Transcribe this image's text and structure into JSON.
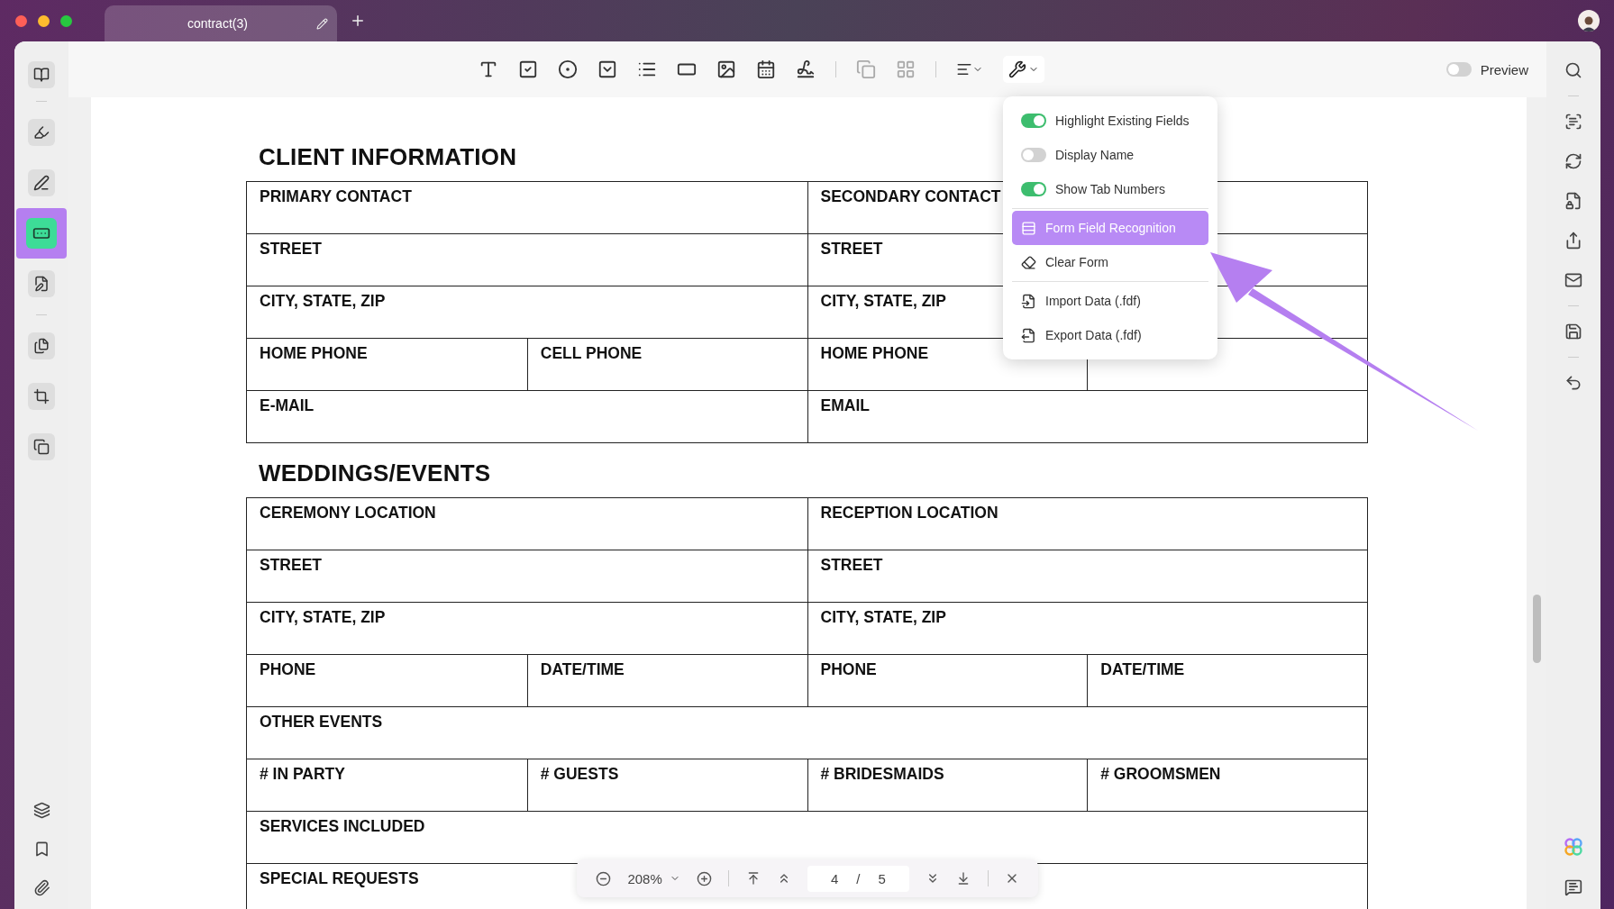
{
  "tab": {
    "title": "contract(3)"
  },
  "left_sidebar": {
    "tools": [
      {
        "selected": false
      },
      {
        "selected": false
      },
      {
        "selected": true
      },
      {
        "selected": false
      },
      {
        "selected": false
      },
      {
        "selected": false
      },
      {
        "selected": false
      }
    ]
  },
  "preview": {
    "label": "Preview",
    "on": false
  },
  "form_menu": {
    "groups": [
      {
        "items": [
          {
            "kind": "toggle",
            "label": "Highlight Existing Fields",
            "on": true
          },
          {
            "kind": "toggle",
            "label": "Display Name",
            "on": false
          },
          {
            "kind": "toggle",
            "label": "Show Tab Numbers",
            "on": true
          }
        ]
      },
      {
        "items": [
          {
            "kind": "action",
            "label": "Form Field Recognition",
            "selected": true
          },
          {
            "kind": "action",
            "label": "Clear Form",
            "selected": false
          }
        ]
      },
      {
        "items": [
          {
            "kind": "action",
            "label": "Import Data (.fdf)",
            "selected": false
          },
          {
            "kind": "action",
            "label": "Export Data (.fdf)",
            "selected": false
          }
        ]
      }
    ]
  },
  "document": {
    "sections": [
      {
        "title": "CLIENT INFORMATION",
        "rows": [
          {
            "cells": [
              {
                "label": "PRIMARY CONTACT"
              },
              {
                "label": "SECONDARY CONTACT"
              }
            ]
          },
          {
            "cells": [
              {
                "label": "STREET"
              },
              {
                "label": "STREET"
              }
            ]
          },
          {
            "cells": [
              {
                "label": "CITY, STATE, ZIP"
              },
              {
                "label": "CITY, STATE, ZIP"
              }
            ]
          },
          {
            "cells": [
              {
                "label": "HOME PHONE"
              },
              {
                "label": "CELL PHONE"
              },
              {
                "label": "HOME PHONE"
              },
              {}
            ]
          },
          {
            "cells": [
              {
                "label": "E-MAIL"
              },
              {
                "label": "EMAIL"
              }
            ]
          }
        ]
      },
      {
        "title": "WEDDINGS/EVENTS",
        "rows": [
          {
            "cells": [
              {
                "label": "CEREMONY LOCATION"
              },
              {
                "label": "RECEPTION LOCATION"
              }
            ]
          },
          {
            "cells": [
              {
                "label": "STREET"
              },
              {
                "label": "STREET"
              }
            ]
          },
          {
            "cells": [
              {
                "label": "CITY, STATE, ZIP"
              },
              {
                "label": "CITY, STATE, ZIP"
              }
            ]
          },
          {
            "cells": [
              {
                "label": "PHONE"
              },
              {
                "label": "DATE/TIME"
              },
              {
                "label": "PHONE"
              },
              {
                "label": "DATE/TIME"
              }
            ]
          },
          {
            "cells": [
              {
                "label": "OTHER EVENTS"
              }
            ]
          },
          {
            "cells": [
              {
                "label": "# IN PARTY"
              },
              {
                "label": "# GUESTS"
              },
              {
                "label": "# BRIDESMAIDS"
              },
              {
                "label": "# GROOMSMEN"
              }
            ]
          },
          {
            "cells": [
              {
                "label": "SERVICES INCLUDED"
              }
            ]
          },
          {
            "cells": [
              {
                "label": "SPECIAL REQUESTS"
              }
            ]
          }
        ]
      }
    ]
  },
  "page_bar": {
    "zoom": "208%",
    "page": "4",
    "separator": "/",
    "total": "5"
  }
}
